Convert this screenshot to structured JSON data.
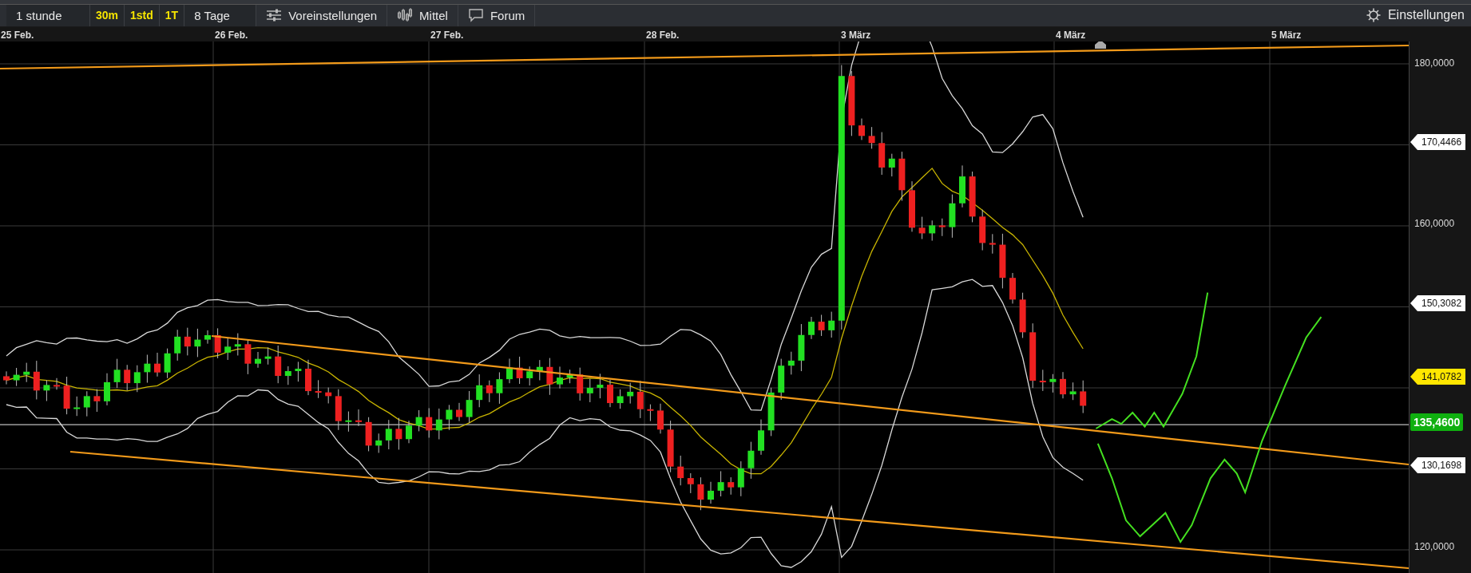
{
  "toolbar": {
    "interval_menu": "1 stunde",
    "quick_ranges": [
      {
        "label": "30m"
      },
      {
        "label": "1std"
      },
      {
        "label": "1T"
      }
    ],
    "range": "8 Tage",
    "presets": "Voreinstellungen",
    "indicator": "Mittel",
    "forum": "Forum",
    "settings": "Einstellungen"
  },
  "date_axis": [
    "25 Feb.",
    "26 Feb.",
    "27 Feb.",
    "28 Feb.",
    "3 März",
    "4 März",
    "5 März"
  ],
  "price_axis": [
    "180,0000",
    "160,0000",
    "120,0000"
  ],
  "price_tags": [
    {
      "label": "170,4466",
      "kind": "level"
    },
    {
      "label": "150,3082",
      "kind": "level"
    },
    {
      "label": "141,0782",
      "kind": "average"
    },
    {
      "label": "135,4600",
      "kind": "last"
    },
    {
      "label": "130,1698",
      "kind": "level"
    }
  ]
}
